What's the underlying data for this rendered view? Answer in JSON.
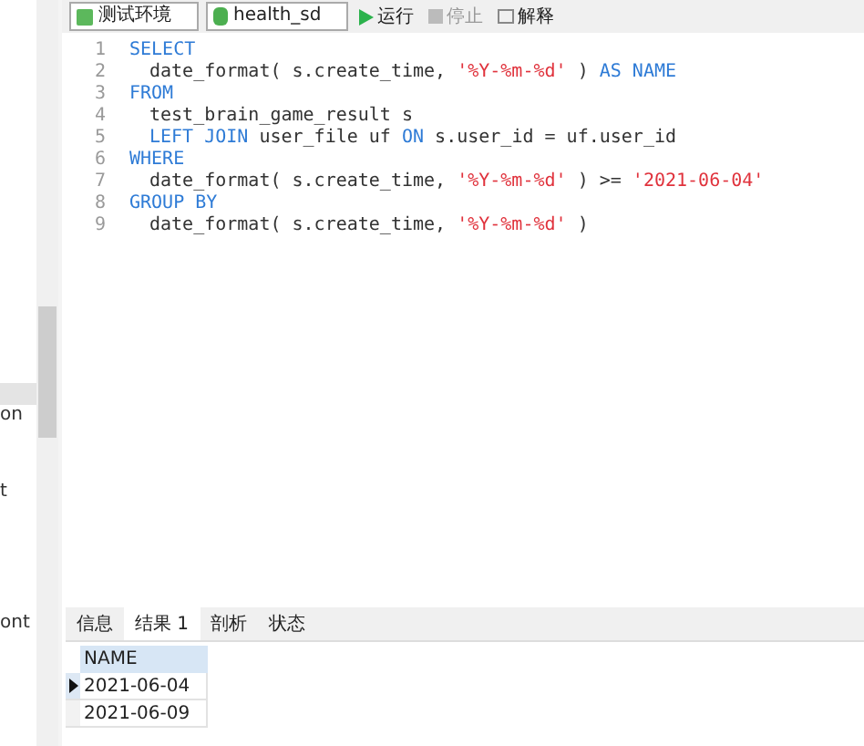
{
  "toolbar": {
    "connection": "测试环境",
    "database": "health_sd",
    "buttons": [
      {
        "kind": "run",
        "label": "运行"
      },
      {
        "kind": "stop",
        "label": "停止"
      },
      {
        "kind": "explain",
        "label": "解释"
      }
    ]
  },
  "side_fragments": [
    "on",
    "t",
    "ont"
  ],
  "editor": {
    "lines": [
      {
        "number": "1",
        "indented": false,
        "tokens": [
          {
            "kind": "keyword",
            "text": "SELECT"
          }
        ]
      },
      {
        "number": "2",
        "indented": true,
        "tokens": [
          {
            "kind": "plain",
            "text": "date_format( s.create_time, "
          },
          {
            "kind": "string",
            "text": "'%Y-%m-%d'"
          },
          {
            "kind": "plain",
            "text": " ) "
          },
          {
            "kind": "keyword",
            "text": "AS NAME"
          }
        ]
      },
      {
        "number": "3",
        "indented": false,
        "tokens": [
          {
            "kind": "keyword",
            "text": "FROM"
          }
        ]
      },
      {
        "number": "4",
        "indented": true,
        "tokens": [
          {
            "kind": "plain",
            "text": "test_brain_game_result s"
          }
        ]
      },
      {
        "number": "5",
        "indented": true,
        "tokens": [
          {
            "kind": "keyword",
            "text": "LEFT JOIN"
          },
          {
            "kind": "plain",
            "text": " user_file uf "
          },
          {
            "kind": "keyword",
            "text": "ON"
          },
          {
            "kind": "plain",
            "text": " s.user_id = uf.user_id"
          }
        ]
      },
      {
        "number": "6",
        "indented": false,
        "tokens": [
          {
            "kind": "keyword",
            "text": "WHERE"
          }
        ]
      },
      {
        "number": "7",
        "indented": true,
        "tokens": [
          {
            "kind": "plain",
            "text": "date_format( s.create_time, "
          },
          {
            "kind": "string",
            "text": "'%Y-%m-%d'"
          },
          {
            "kind": "plain",
            "text": " ) >= "
          },
          {
            "kind": "string",
            "text": "'2021-06-04'"
          }
        ]
      },
      {
        "number": "8",
        "indented": false,
        "tokens": [
          {
            "kind": "keyword",
            "text": "GROUP BY"
          }
        ]
      },
      {
        "number": "9",
        "indented": true,
        "tokens": [
          {
            "kind": "plain",
            "text": "date_format( s.create_time, "
          },
          {
            "kind": "string",
            "text": "'%Y-%m-%d'"
          },
          {
            "kind": "plain",
            "text": " )"
          }
        ]
      }
    ]
  },
  "result_tabs": [
    {
      "label": "信息",
      "selected": false
    },
    {
      "label": "结果 1",
      "selected": true
    },
    {
      "label": "剖析",
      "selected": false
    },
    {
      "label": "状态",
      "selected": false
    }
  ],
  "table": {
    "columns": [
      "NAME"
    ],
    "rows": [
      {
        "cells": [
          "2021-06-04"
        ],
        "selected": true
      },
      {
        "cells": [
          "2021-06-09"
        ],
        "selected": false
      }
    ]
  }
}
